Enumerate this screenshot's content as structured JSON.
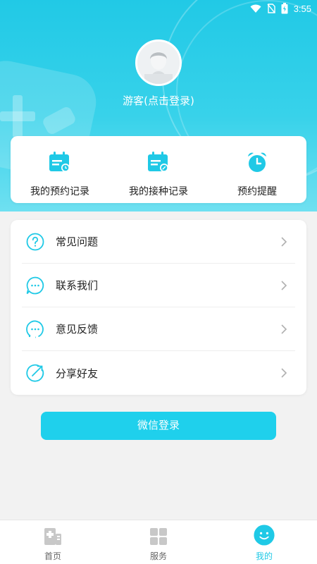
{
  "status_bar": {
    "time": "3:55"
  },
  "profile": {
    "guest_label": "游客(点击登录)"
  },
  "quick_actions": [
    {
      "label": "我的预约记录",
      "icon": "appointment-calendar-icon"
    },
    {
      "label": "我的接种记录",
      "icon": "vaccination-calendar-icon"
    },
    {
      "label": "预约提醒",
      "icon": "alarm-clock-icon"
    }
  ],
  "menu": [
    {
      "label": "常见问题",
      "icon": "question-icon"
    },
    {
      "label": "联系我们",
      "icon": "chat-bubble-icon"
    },
    {
      "label": "意见反馈",
      "icon": "feedback-icon"
    },
    {
      "label": "分享好友",
      "icon": "share-icon"
    }
  ],
  "login_button": {
    "label": "微信登录"
  },
  "bottom_nav": [
    {
      "label": "首页",
      "icon": "home-icon",
      "active": false
    },
    {
      "label": "服务",
      "icon": "grid-icon",
      "active": false
    },
    {
      "label": "我的",
      "icon": "smile-icon",
      "active": true
    }
  ],
  "colors": {
    "accent": "#1fc9e6",
    "header": "#21c9e6",
    "background": "#f2f2f2"
  }
}
